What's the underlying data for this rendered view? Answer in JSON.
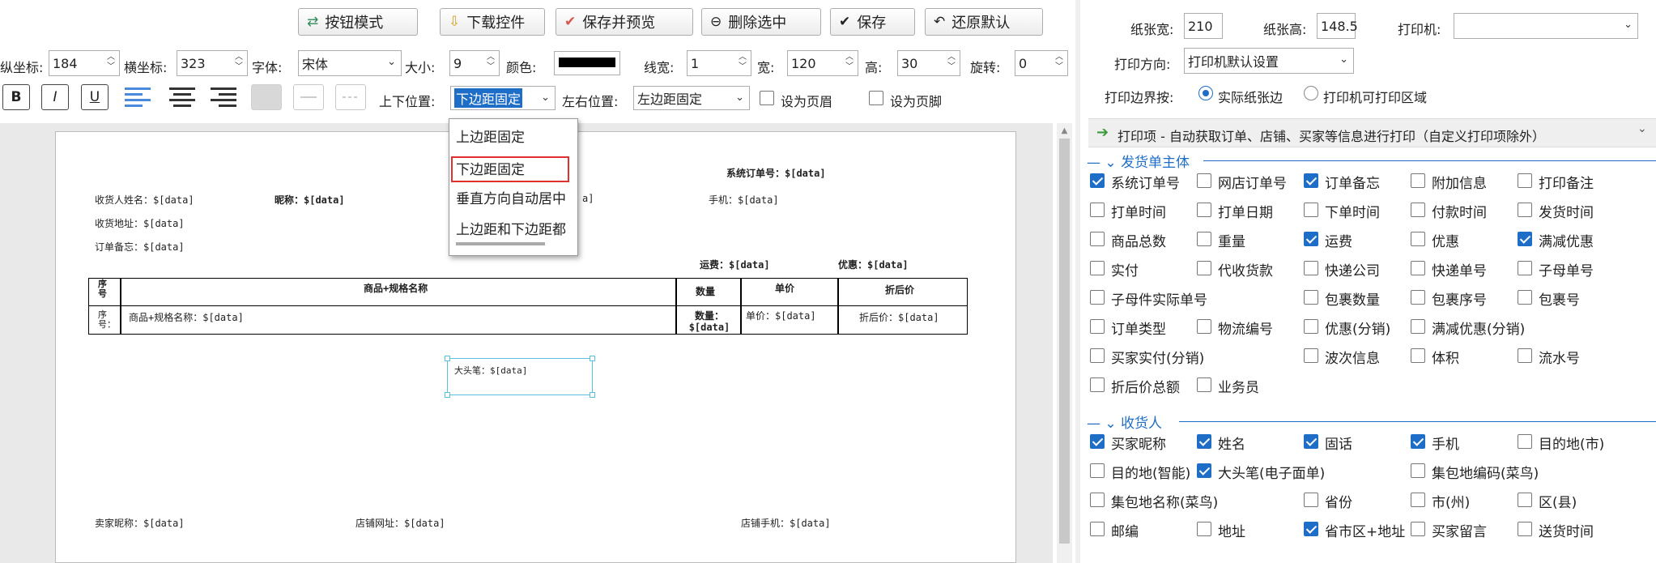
{
  "toolbar": {
    "buttons": [
      {
        "icon": "⇄",
        "label": "按钮模式"
      },
      {
        "icon": "⇩",
        "label": "下载控件"
      },
      {
        "icon": "✔",
        "label": "保存并预览"
      },
      {
        "icon": "⊖",
        "label": "删除选中"
      },
      {
        "icon": "✔",
        "label": "保存"
      },
      {
        "icon": "↶",
        "label": "还原默认"
      }
    ]
  },
  "props": {
    "y_label": "纵坐标:",
    "y_value": "184",
    "x_label": "横坐标:",
    "x_value": "323",
    "font_label": "字体:",
    "font_value": "宋体",
    "size_label": "大小:",
    "size_value": "9",
    "color_label": "颜色:",
    "color_value": "#000000",
    "linewidth_label": "线宽:",
    "linewidth_value": "1",
    "width_label": "宽:",
    "width_value": "120",
    "height_label": "高:",
    "height_value": "30",
    "rotate_label": "旋转:",
    "rotate_value": "0",
    "bold": "B",
    "italic": "I",
    "underline": "U",
    "vpos_label": "上下位置:",
    "vpos_value": "下边距固定",
    "hpos_label": "左右位置:",
    "hpos_value": "左边距固定",
    "header_label": "设为页眉",
    "footer_label": "设为页脚"
  },
  "dropdown": {
    "options": [
      "上边距固定",
      "下边距固定",
      "垂直方向自动居中",
      "上边距和下边距都"
    ],
    "selected_index": 1
  },
  "paper": {
    "order_no": "系统订单号：$[data]",
    "receiver_name": "收货人姓名：$[data]",
    "nickname": "昵称：$[data]",
    "nickname_tail": "a]",
    "phone": "手机：$[data]",
    "address": "收货地址：$[data]",
    "order_memo": "订单备忘：$[data]",
    "freight": "运费：$[data]",
    "discount": "优惠：$[data]",
    "table_headers": [
      "序号",
      "商品+规格名称",
      "数量",
      "单价",
      "折后价"
    ],
    "table_row": [
      "序号：",
      "商品+规格名称：$[data]",
      "数量：$[data]",
      "单价：$[data]",
      "折后价：$[data]"
    ],
    "big_pen": "大头笔：$[data]",
    "seller_nick": "卖家昵称：$[data]",
    "shop_url": "店铺网址：$[data]",
    "shop_phone": "店铺手机：$[data]"
  },
  "settings": {
    "paper_width_label": "纸张宽:",
    "paper_width": "210",
    "paper_height_label": "纸张高:",
    "paper_height": "148.5",
    "printer_label": "打印机:",
    "printer_value": "",
    "orientation_label": "打印方向:",
    "orientation_value": "打印机默认设置",
    "border_label": "打印边界按:",
    "border_opt1": "实际纸张边",
    "border_opt2": "打印机可打印区域",
    "print_items_header": "打印项 - 自动获取订单、店铺、买家等信息进行打印（自定义打印项除外）"
  },
  "sections": [
    {
      "title": "发货单主体",
      "rows": [
        [
          {
            "label": "系统订单号",
            "checked": true
          },
          {
            "label": "网店订单号",
            "checked": false
          },
          {
            "label": "订单备忘",
            "checked": true
          },
          {
            "label": "附加信息",
            "checked": false
          },
          {
            "label": "打印备注",
            "checked": false
          }
        ],
        [
          {
            "label": "打单时间",
            "checked": false
          },
          {
            "label": "打单日期",
            "checked": false
          },
          {
            "label": "下单时间",
            "checked": false
          },
          {
            "label": "付款时间",
            "checked": false
          },
          {
            "label": "发货时间",
            "checked": false
          }
        ],
        [
          {
            "label": "商品总数",
            "checked": false
          },
          {
            "label": "重量",
            "checked": false
          },
          {
            "label": "运费",
            "checked": true
          },
          {
            "label": "优惠",
            "checked": false
          },
          {
            "label": "满减优惠",
            "checked": true
          }
        ],
        [
          {
            "label": "实付",
            "checked": false
          },
          {
            "label": "代收货款",
            "checked": false
          },
          {
            "label": "快递公司",
            "checked": false
          },
          {
            "label": "快递单号",
            "checked": false
          },
          {
            "label": "子母单号",
            "checked": false
          }
        ],
        [
          {
            "label": "子母件实际单号",
            "checked": false
          },
          null,
          {
            "label": "包裹数量",
            "checked": false
          },
          {
            "label": "包裹序号",
            "checked": false
          },
          {
            "label": "包裹号",
            "checked": false
          }
        ],
        [
          {
            "label": "订单类型",
            "checked": false
          },
          {
            "label": "物流编号",
            "checked": false
          },
          {
            "label": "优惠(分销)",
            "checked": false
          },
          {
            "label": "满减优惠(分销)",
            "checked": false
          },
          null
        ],
        [
          {
            "label": "买家实付(分销)",
            "checked": false
          },
          null,
          {
            "label": "波次信息",
            "checked": false
          },
          {
            "label": "体积",
            "checked": false
          },
          {
            "label": "流水号",
            "checked": false
          }
        ],
        [
          {
            "label": "折后价总额",
            "checked": false
          },
          {
            "label": "业务员",
            "checked": false
          },
          null,
          null,
          null
        ]
      ]
    },
    {
      "title": "收货人",
      "rows": [
        [
          {
            "label": "买家昵称",
            "checked": true
          },
          {
            "label": "姓名",
            "checked": true
          },
          {
            "label": "固话",
            "checked": true
          },
          {
            "label": "手机",
            "checked": true
          },
          {
            "label": "目的地(市)",
            "checked": false
          }
        ],
        [
          {
            "label": "目的地(智能)",
            "checked": false
          },
          {
            "label": "大头笔(电子面单)",
            "checked": true
          },
          null,
          {
            "label": "集包地编码(菜鸟)",
            "checked": false
          },
          null
        ],
        [
          {
            "label": "集包地名称(菜鸟)",
            "checked": false
          },
          null,
          {
            "label": "省份",
            "checked": false
          },
          {
            "label": "市(州)",
            "checked": false
          },
          {
            "label": "区(县)",
            "checked": false
          }
        ],
        [
          {
            "label": "邮编",
            "checked": false
          },
          {
            "label": "地址",
            "checked": false
          },
          {
            "label": "省市区+地址",
            "checked": true
          },
          {
            "label": "买家留言",
            "checked": false
          },
          {
            "label": "送货时间",
            "checked": false
          }
        ]
      ]
    }
  ]
}
